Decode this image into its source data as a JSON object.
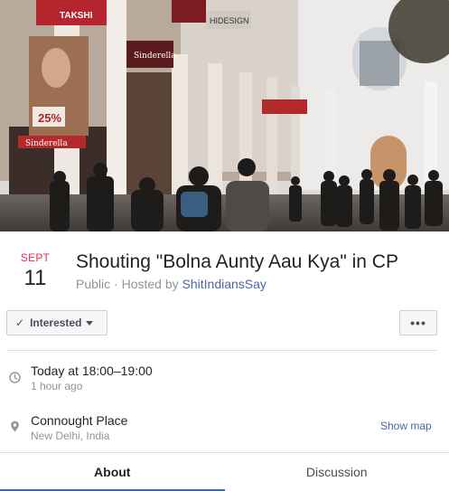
{
  "cover": {
    "alt_signs": [
      "TAKSHI",
      "Sinderella",
      "25%",
      "Sinderella",
      "HIDESIGN"
    ]
  },
  "event": {
    "month": "SEPT",
    "day": "11",
    "title": "Shouting \"Bolna Aunty Aau Kya\" in CP",
    "visibility": "Public",
    "separator": " · ",
    "hosted_by_prefix": "Hosted by ",
    "host": "ShitIndiansSay"
  },
  "actions": {
    "interested_label": "Interested",
    "more_label": "•••"
  },
  "time": {
    "main": "Today at 18:00–19:00",
    "sub": "1 hour ago"
  },
  "location": {
    "main": "Connought Place",
    "sub": "New Delhi, India",
    "show_map": "Show map"
  },
  "tabs": [
    {
      "label": "About",
      "active": true
    },
    {
      "label": "Discussion",
      "active": false
    }
  ],
  "colors": {
    "month_red": "#f02849",
    "link_blue": "#4b67a1",
    "tab_underline": "#4267b2"
  }
}
